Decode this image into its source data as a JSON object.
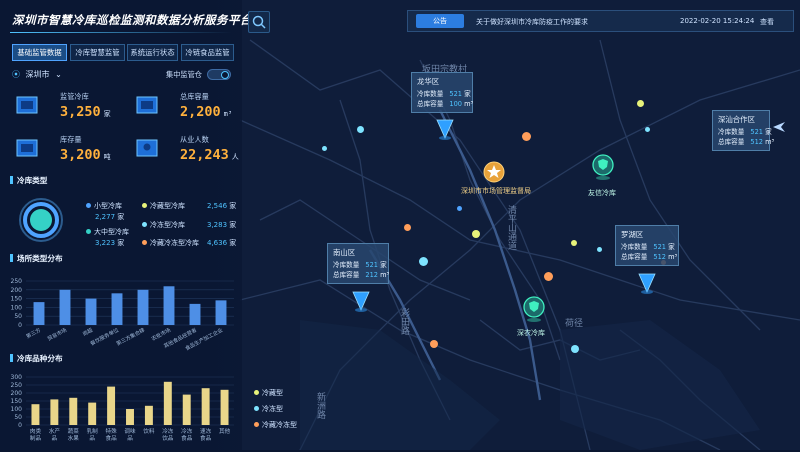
{
  "header": {
    "title": "深圳市智慧冷库巡检监测和数据分析服务平台",
    "search_icon": "search-icon"
  },
  "tabs": [
    {
      "label": "基础监管数据",
      "active": true
    },
    {
      "label": "冷库智慧监管",
      "active": false
    },
    {
      "label": "系统运行状态",
      "active": false
    },
    {
      "label": "冷链食品监管",
      "active": false
    }
  ],
  "city_selector": {
    "value": "深圳市"
  },
  "toggle": {
    "label": "集中监管仓",
    "on": true
  },
  "stats": [
    {
      "label": "监管冷库",
      "value": "3,250",
      "unit": "家"
    },
    {
      "label": "总库容量",
      "value": "2,200",
      "unit": "m³"
    },
    {
      "label": "库存量",
      "value": "3,200",
      "unit": "吨"
    },
    {
      "label": "从业人数",
      "value": "22,243",
      "unit": "人"
    }
  ],
  "cold_types": {
    "title": "冷库类型",
    "items": [
      {
        "name": "小型冷库",
        "value": "2,277",
        "unit": "家",
        "color": "#4fa3ff"
      },
      {
        "name": "大中型冷库",
        "value": "3,223",
        "unit": "家",
        "color": "#35d1c6"
      }
    ],
    "right_items": [
      {
        "name": "冷藏型冷库",
        "value": "2,546",
        "unit": "家",
        "color": "#e7f27a"
      },
      {
        "name": "冷冻型冷库",
        "value": "3,283",
        "unit": "家",
        "color": "#7ee3ff"
      },
      {
        "name": "冷藏冷冻型冷库",
        "value": "4,636",
        "unit": "家",
        "color": "#ff9e5a"
      }
    ]
  },
  "chart1_title": "场所类型分布",
  "chart2_title": "冷库品种分布",
  "chart_data": [
    {
      "type": "bar",
      "categories": [
        "第三方",
        "贸易市场",
        "商超",
        "餐饮服务单位",
        "第三方集合肆",
        "农批市场",
        "其他食品经营者",
        "食品生产加工企业"
      ],
      "values": [
        130,
        200,
        150,
        180,
        200,
        220,
        120,
        140
      ],
      "ylim": [
        0,
        250
      ],
      "yticks": [
        0,
        50,
        100,
        150,
        200,
        250
      ],
      "color": "#4e8fe6"
    },
    {
      "type": "bar",
      "categories": [
        "肉类制品",
        "水产品",
        "蔬菜水果",
        "乳制品",
        "特殊食品",
        "调味品",
        "饮料",
        "冷冻饮品",
        "冷冻食品",
        "速冻食品",
        "其他"
      ],
      "values": [
        130,
        160,
        170,
        140,
        240,
        100,
        120,
        270,
        190,
        230,
        220
      ],
      "ylim": [
        0,
        300
      ],
      "yticks": [
        0,
        50,
        100,
        150,
        200,
        250,
        300
      ],
      "color": "#e9d68a"
    }
  ],
  "notice": {
    "badge": "公告",
    "text": "关于做好深圳市冷库防疫工作的要求",
    "time": "2022-02-20  15:24:24",
    "action": "查看"
  },
  "popups": [
    {
      "name": "龙华区",
      "rows": [
        [
          "冷库数量",
          "521",
          "家"
        ],
        [
          "总库容量",
          "100",
          "m³"
        ]
      ]
    },
    {
      "name": "南山区",
      "rows": [
        [
          "冷库数量",
          "521",
          "家"
        ],
        [
          "总库容量",
          "212",
          "m³"
        ]
      ]
    },
    {
      "name": "罗湖区",
      "rows": [
        [
          "冷库数量",
          "521",
          "家"
        ],
        [
          "总库容量",
          "512",
          "m³"
        ]
      ]
    },
    {
      "name": "深汕合作区",
      "rows": [
        [
          "冷库数量",
          "521",
          "家"
        ],
        [
          "总库容量",
          "512",
          "m³"
        ]
      ]
    }
  ],
  "map_labels": {
    "center": "深圳市市场管理监督局",
    "youxin": "友信冷库",
    "shennong": "深农冷库"
  },
  "road_labels": {
    "r1": "坂田宗教村",
    "r2": "清平山通道",
    "r3": "彩田路",
    "r4": "新洲路",
    "r5": "荷径"
  },
  "map_legend": [
    {
      "label": "冷藏型",
      "color": "#e7f27a"
    },
    {
      "label": "冷冻型",
      "color": "#7ee3ff"
    },
    {
      "label": "冷藏冷冻型",
      "color": "#ff9e5a"
    }
  ]
}
